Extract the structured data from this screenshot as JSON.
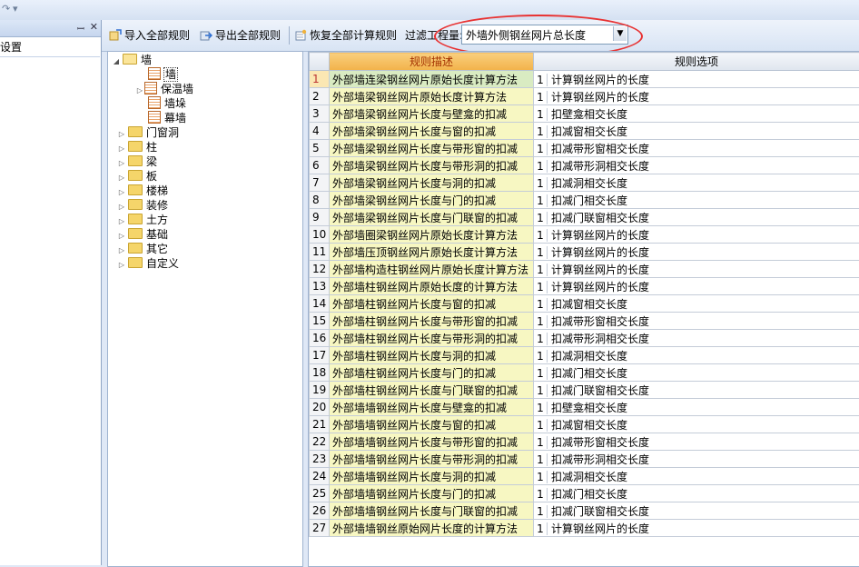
{
  "left_panel": {
    "title": "设置"
  },
  "toolbar": {
    "import_label": "导入全部规则",
    "export_label": "导出全部规则",
    "restore_label": "恢复全部计算规则",
    "filter_label": "过滤工程量:",
    "filter_value": "外墙外侧钢丝网片总长度"
  },
  "tree": {
    "root": "墙",
    "children": [
      "墙",
      "保温墙",
      "墙垛",
      "幕墙"
    ],
    "folders": [
      "门窗洞",
      "柱",
      "梁",
      "板",
      "楼梯",
      "装修",
      "土方",
      "基础",
      "其它",
      "自定义"
    ]
  },
  "grid": {
    "columns": [
      "规则描述",
      "规则选项"
    ],
    "rows": [
      {
        "n": "1",
        "desc": "外部墙连梁钢丝网片原始长度计算方法",
        "idx": "1",
        "opt": "计算钢丝网片的长度"
      },
      {
        "n": "2",
        "desc": "外部墙梁钢丝网片原始长度计算方法",
        "idx": "1",
        "opt": "计算钢丝网片的长度"
      },
      {
        "n": "3",
        "desc": "外部墙梁钢丝网片长度与壁龛的扣减",
        "idx": "1",
        "opt": "扣壁龛相交长度"
      },
      {
        "n": "4",
        "desc": "外部墙梁钢丝网片长度与窗的扣减",
        "idx": "1",
        "opt": "扣减窗相交长度"
      },
      {
        "n": "5",
        "desc": "外部墙梁钢丝网片长度与带形窗的扣减",
        "idx": "1",
        "opt": "扣减带形窗相交长度"
      },
      {
        "n": "6",
        "desc": "外部墙梁钢丝网片长度与带形洞的扣减",
        "idx": "1",
        "opt": "扣减带形洞相交长度"
      },
      {
        "n": "7",
        "desc": "外部墙梁钢丝网片长度与洞的扣减",
        "idx": "1",
        "opt": "扣减洞相交长度"
      },
      {
        "n": "8",
        "desc": "外部墙梁钢丝网片长度与门的扣减",
        "idx": "1",
        "opt": "扣减门相交长度"
      },
      {
        "n": "9",
        "desc": "外部墙梁钢丝网片长度与门联窗的扣减",
        "idx": "1",
        "opt": "扣减门联窗相交长度"
      },
      {
        "n": "10",
        "desc": "外部墙圈梁钢丝网片原始长度计算方法",
        "idx": "1",
        "opt": "计算钢丝网片的长度"
      },
      {
        "n": "11",
        "desc": "外部墙压顶钢丝网片原始长度计算方法",
        "idx": "1",
        "opt": "计算钢丝网片的长度"
      },
      {
        "n": "12",
        "desc": "外部墙构造柱钢丝网片原始长度计算方法",
        "idx": "1",
        "opt": "计算钢丝网片的长度"
      },
      {
        "n": "13",
        "desc": "外部墙柱钢丝网片原始长度的计算方法",
        "idx": "1",
        "opt": "计算钢丝网片的长度"
      },
      {
        "n": "14",
        "desc": "外部墙柱钢丝网片长度与窗的扣减",
        "idx": "1",
        "opt": "扣减窗相交长度"
      },
      {
        "n": "15",
        "desc": "外部墙柱钢丝网片长度与带形窗的扣减",
        "idx": "1",
        "opt": "扣减带形窗相交长度"
      },
      {
        "n": "16",
        "desc": "外部墙柱钢丝网片长度与带形洞的扣减",
        "idx": "1",
        "opt": "扣减带形洞相交长度"
      },
      {
        "n": "17",
        "desc": "外部墙柱钢丝网片长度与洞的扣减",
        "idx": "1",
        "opt": "扣减洞相交长度"
      },
      {
        "n": "18",
        "desc": "外部墙柱钢丝网片长度与门的扣减",
        "idx": "1",
        "opt": "扣减门相交长度"
      },
      {
        "n": "19",
        "desc": "外部墙柱钢丝网片长度与门联窗的扣减",
        "idx": "1",
        "opt": "扣减门联窗相交长度"
      },
      {
        "n": "20",
        "desc": "外部墙墙钢丝网片长度与壁龛的扣减",
        "idx": "1",
        "opt": "扣壁龛相交长度"
      },
      {
        "n": "21",
        "desc": "外部墙墙钢丝网片长度与窗的扣减",
        "idx": "1",
        "opt": "扣减窗相交长度"
      },
      {
        "n": "22",
        "desc": "外部墙墙钢丝网片长度与带形窗的扣减",
        "idx": "1",
        "opt": "扣减带形窗相交长度"
      },
      {
        "n": "23",
        "desc": "外部墙墙钢丝网片长度与带形洞的扣减",
        "idx": "1",
        "opt": "扣减带形洞相交长度"
      },
      {
        "n": "24",
        "desc": "外部墙墙钢丝网片长度与洞的扣减",
        "idx": "1",
        "opt": "扣减洞相交长度"
      },
      {
        "n": "25",
        "desc": "外部墙墙钢丝网片长度与门的扣减",
        "idx": "1",
        "opt": "扣减门相交长度"
      },
      {
        "n": "26",
        "desc": "外部墙墙钢丝网片长度与门联窗的扣减",
        "idx": "1",
        "opt": "扣减门联窗相交长度"
      },
      {
        "n": "27",
        "desc": "外部墙墙钢丝原始网片长度的计算方法",
        "idx": "1",
        "opt": "计算钢丝网片的长度"
      }
    ]
  }
}
